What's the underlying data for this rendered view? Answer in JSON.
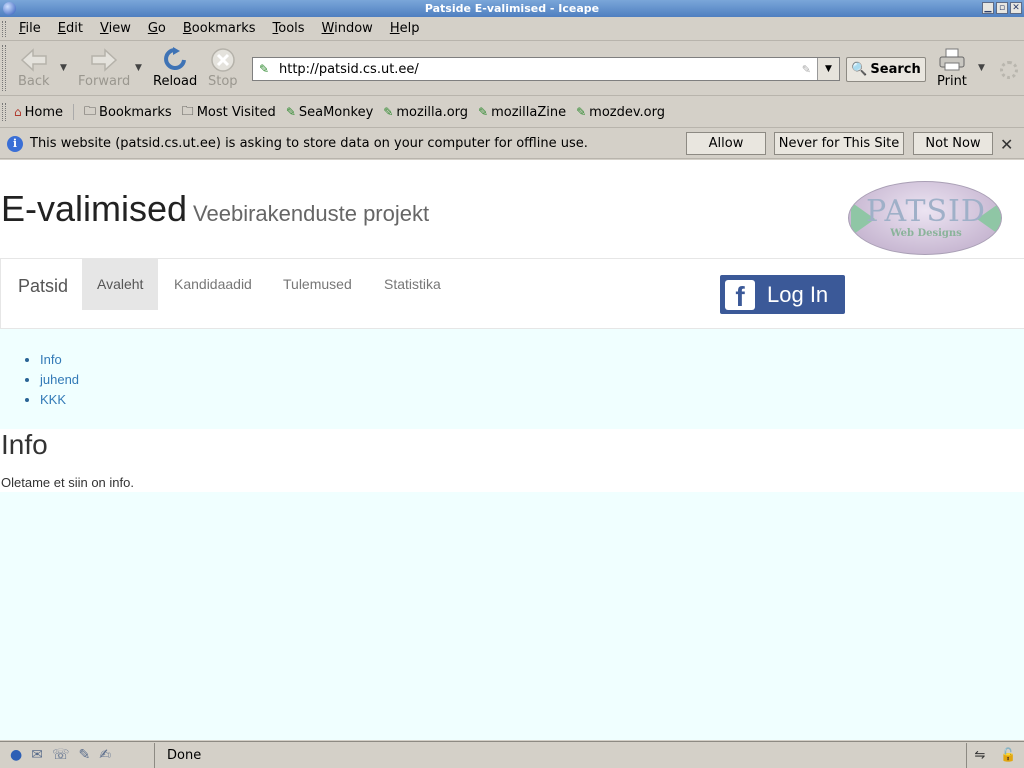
{
  "window": {
    "title": "Patside E-valimised - Iceape",
    "buttons": [
      "▁",
      "▫",
      "✕"
    ]
  },
  "menubar": {
    "items": [
      {
        "label": "File",
        "key": "F",
        "rest": "ile"
      },
      {
        "label": "Edit",
        "key": "E",
        "rest": "dit"
      },
      {
        "label": "View",
        "key": "V",
        "rest": "iew"
      },
      {
        "label": "Go",
        "key": "G",
        "rest": "o"
      },
      {
        "label": "Bookmarks",
        "key": "B",
        "rest": "ookmarks"
      },
      {
        "label": "Tools",
        "key": "T",
        "rest": "ools"
      },
      {
        "label": "Window",
        "key": "W",
        "rest": "indow"
      },
      {
        "label": "Help",
        "key": "H",
        "rest": "elp"
      }
    ]
  },
  "navbar": {
    "back": "Back",
    "forward": "Forward",
    "reload": "Reload",
    "stop": "Stop",
    "url": "http://patsid.cs.ut.ee/",
    "search": "Search",
    "print": "Print",
    "icons": {
      "back": "left-arrow-icon",
      "forward": "right-arrow-icon",
      "reload": "reload-icon",
      "stop": "stop-icon",
      "search": "magnifier-icon",
      "print": "printer-icon"
    }
  },
  "bookmarks": {
    "home": "Home",
    "bookmarks": "Bookmarks",
    "most_visited": "Most Visited",
    "items": [
      "SeaMonkey",
      "mozilla.org",
      "mozillaZine",
      "mozdev.org"
    ]
  },
  "infobar": {
    "message": "This website (patsid.cs.ut.ee) is asking to store data on your computer for offline use.",
    "allow": "Allow",
    "never": "Never for This Site",
    "not_now": "Not Now"
  },
  "page": {
    "title": "E-valimised",
    "subtitle": "Veebirakenduste projekt",
    "logo_text": "PATSID",
    "logo_sub": "Web Designs",
    "brand": "Patsid",
    "nav": [
      "Avaleht",
      "Kandidaadid",
      "Tulemused",
      "Statistika"
    ],
    "active_nav": "Avaleht",
    "login": "Log In",
    "sidebar_links": [
      "Info",
      "juhend",
      "KKK"
    ],
    "heading": "Info",
    "text": "Oletame et siin on info.",
    "colors": {
      "background": "#f0ffff",
      "link": "#337ab7",
      "facebook": "#3b5998"
    }
  },
  "statusbar": {
    "text": "Done"
  }
}
